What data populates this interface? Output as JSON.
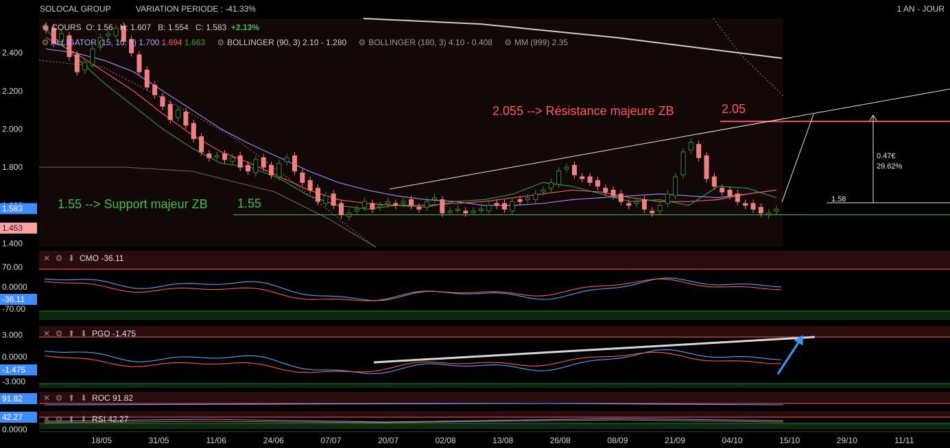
{
  "header": {
    "instrument": "SOLOCAL GROUP",
    "variation": "VARIATION PERIODE : -41.33%",
    "timeframe": "1 AN - JOUR"
  },
  "legend": {
    "cours_label": "COURS",
    "o_label": "O:",
    "o_value": "1.56",
    "h_label": "H:",
    "h_value": "1.607",
    "b_label": "B:",
    "b_value": "1.554",
    "c_label": "C:",
    "c_value": "1.583",
    "change": "+2.13%",
    "alligator_label": "ALLIGATOR (15, 10, 5)",
    "alligator_v1": "1.700",
    "alligator_v2": "1.694",
    "alligator_v3": "1.663",
    "bollinger1": "BOLLINGER (90, 3) 2.10 - 1.280",
    "bollinger2": "BOLLINGER (180, 3) 4.10 - 0.408",
    "mm": "MM (999) 2.35"
  },
  "colors": {
    "bull": "#3a8a2a",
    "bear": "#f08080",
    "alligator_blue": "#9b95ff",
    "alligator_red": "#ff6060",
    "alligator_green": "#3aa030",
    "resistance": "#ff5a5a",
    "support": "#40c040",
    "osc_blue": "#4aa8ff",
    "osc_red": "#ff5a3a",
    "panel_red": "#2a0c0c",
    "panel_green": "#0a2a10"
  },
  "indicators": {
    "cmo_label": "CMO -36.11",
    "pgo_label": "PGO -1.475",
    "roc_label": "ROC 91.82",
    "rsi_label": "RSI 42.27",
    "cmo_badge": "-36.11",
    "pgo_badge": "-1.475",
    "roc_badge": "91.82",
    "rsi_badge": "42.27",
    "cmo_ticks": [
      "70.00",
      "0.0000",
      "-70.00"
    ],
    "pgo_ticks": [
      "3.000",
      "0.0000",
      "-3.000"
    ],
    "roc_ticks": [
      "91.82"
    ],
    "rsi_ticks": [
      "0.0000"
    ]
  },
  "annotations": {
    "resistance_text": "2.055 --> Résistance majeure ZB",
    "resistance_value": "2.05",
    "support_text": "1.55 --> Support majeur ZB",
    "support_value": "1.55",
    "target_pct": "0.47€",
    "target_pct2": "29.62%",
    "level_158": "1.58"
  },
  "chart_data": {
    "type": "candlestick",
    "title": "SOLOCAL GROUP",
    "ylim": [
      1.38,
      2.58
    ],
    "y_ticks": [
      "2.400",
      "2.200",
      "2.000",
      "1.800",
      "1.600",
      "1.400"
    ],
    "last_price_badge": "1.583",
    "low_badge": "1.453",
    "x_labels": [
      "18/05",
      "31/05",
      "11/06",
      "24/06",
      "07/07",
      "20/07",
      "02/08",
      "13/08",
      "26/08",
      "08/09",
      "21/09",
      "04/10",
      "15/10",
      "29/10",
      "11/11"
    ],
    "resistance": 2.04,
    "support": 1.55,
    "close_series": [
      2.52,
      2.45,
      2.5,
      2.38,
      2.3,
      2.35,
      2.42,
      2.48,
      2.5,
      2.53,
      2.46,
      2.4,
      2.3,
      2.22,
      2.18,
      2.12,
      2.05,
      2.1,
      2.02,
      1.95,
      1.88,
      1.85,
      1.86,
      1.84,
      1.85,
      1.8,
      1.78,
      1.84,
      1.8,
      1.76,
      1.82,
      1.85,
      1.78,
      1.72,
      1.68,
      1.62,
      1.65,
      1.6,
      1.55,
      1.56,
      1.58,
      1.62,
      1.58,
      1.6,
      1.62,
      1.6,
      1.62,
      1.6,
      1.58,
      1.62,
      1.64,
      1.56,
      1.57,
      1.58,
      1.56,
      1.57,
      1.58,
      1.6,
      1.6,
      1.58,
      1.62,
      1.62,
      1.64,
      1.66,
      1.68,
      1.72,
      1.78,
      1.8,
      1.76,
      1.74,
      1.72,
      1.7,
      1.67,
      1.65,
      1.62,
      1.6,
      1.62,
      1.58,
      1.56,
      1.6,
      1.66,
      1.75,
      1.88,
      1.93,
      1.85,
      1.74,
      1.7,
      1.67,
      1.65,
      1.62,
      1.6,
      1.58,
      1.56,
      1.56,
      1.58
    ],
    "series": [
      {
        "name": "ALLIGATOR blue",
        "values": [
          2.42,
          2.4,
          2.36,
          2.3,
          2.2,
          2.1,
          2.0,
          1.92,
          1.85,
          1.78,
          1.72,
          1.68,
          1.65,
          1.63,
          1.62,
          1.6,
          1.6,
          1.61,
          1.63,
          1.64,
          1.65,
          1.66,
          1.65,
          1.64,
          1.66,
          1.68
        ]
      },
      {
        "name": "ALLIGATOR red",
        "values": [
          2.48,
          2.4,
          2.3,
          2.2,
          2.08,
          1.97,
          1.88,
          1.82,
          1.75,
          1.68,
          1.63,
          1.61,
          1.6,
          1.6,
          1.61,
          1.62,
          1.64,
          1.66,
          1.68,
          1.67,
          1.64,
          1.62,
          1.62,
          1.63,
          1.66,
          1.68
        ]
      },
      {
        "name": "ALLIGATOR green",
        "values": [
          2.52,
          2.38,
          2.24,
          2.12,
          2.0,
          1.9,
          1.82,
          1.8,
          1.74,
          1.65,
          1.6,
          1.58,
          1.6,
          1.59,
          1.62,
          1.63,
          1.66,
          1.72,
          1.7,
          1.66,
          1.62,
          1.63,
          1.6,
          1.7,
          1.69,
          1.64
        ]
      }
    ]
  }
}
